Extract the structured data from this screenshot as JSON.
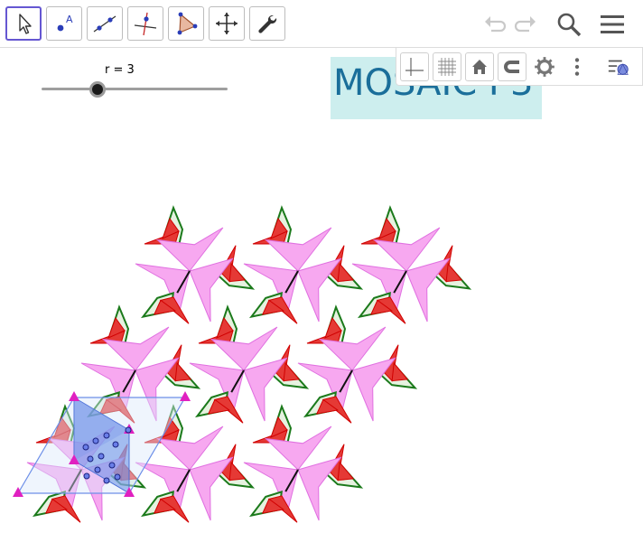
{
  "toolbar": {
    "tools": [
      {
        "name": "move-tool-button",
        "icon": "arrow-pointer-icon",
        "active": true
      },
      {
        "name": "point-tool-button",
        "icon": "point-a-icon",
        "active": false
      },
      {
        "name": "line-tool-button",
        "icon": "line-icon",
        "active": false
      },
      {
        "name": "perpendicular-tool-button",
        "icon": "perpendicular-line-icon",
        "active": false
      },
      {
        "name": "polygon-tool-button",
        "icon": "polygon-icon",
        "active": false
      },
      {
        "name": "move-graphics-tool-button",
        "icon": "move-cross-icon",
        "active": false
      },
      {
        "name": "tools-button",
        "icon": "wrench-icon",
        "active": false
      }
    ],
    "undo_icon": "undo-icon",
    "redo_icon": "redo-icon",
    "search_icon": "search-icon",
    "menu_icon": "hamburger-menu-icon"
  },
  "stylebar": {
    "buttons": [
      "axes-icon",
      "grid-icon",
      "home-icon",
      "magnet-icon",
      "gear-icon",
      "more-vertical-icon"
    ],
    "toggle_icon": "style-bar-toggle-icon"
  },
  "slider": {
    "label": "r = 3",
    "value": 3,
    "min": 0,
    "max": 10
  },
  "title": {
    "text": "MOSAIC P3"
  },
  "colors": {
    "accent": "#6557d2",
    "title_bg": "#cdeeee",
    "title_text": "#1a6e9a",
    "red_fill": "#e53935",
    "green_stroke": "#1b7a1b",
    "pink_fill": "#f7a8f0",
    "magenta_vertex": "#e020c0",
    "blue_cell": "#6d8fe8"
  }
}
